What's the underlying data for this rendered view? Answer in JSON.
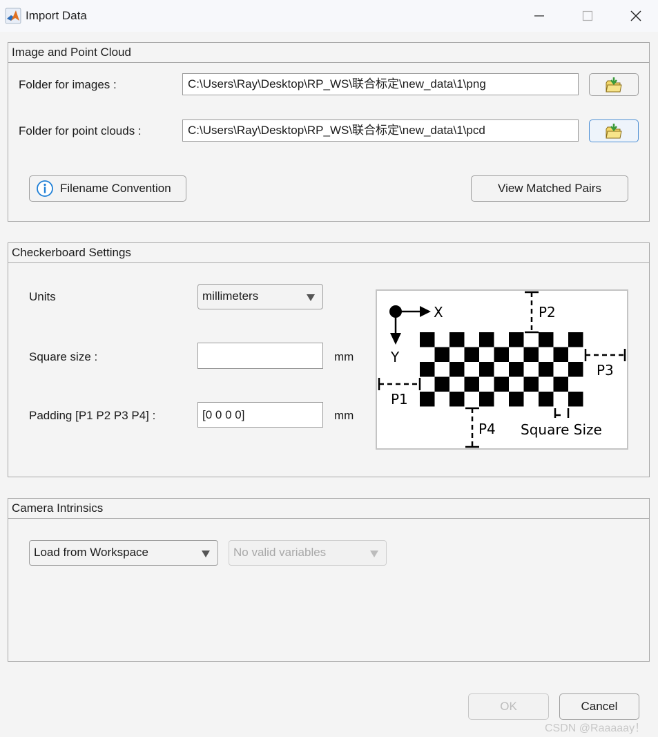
{
  "window": {
    "title": "Import Data",
    "app_icon": "matlab-icon",
    "controls": [
      "minimize-icon",
      "maximize-icon",
      "close-icon"
    ]
  },
  "image_panel": {
    "title": "Image and Point Cloud",
    "images_label": "Folder for images :",
    "images_path": "C:\\Users\\Ray\\Desktop\\RP_WS\\联合标定\\new_data\\1\\png",
    "clouds_label": "Folder for point clouds :",
    "clouds_path": "C:\\Users\\Ray\\Desktop\\RP_WS\\联合标定\\new_data\\1\\pcd",
    "browse_icon": "folder-open-icon",
    "filename_convention_label": "Filename Convention",
    "view_pairs_label": "View Matched Pairs"
  },
  "checkerboard_panel": {
    "title": "Checkerboard Settings",
    "units_label": "Units",
    "units_value": "millimeters",
    "square_size_label": "Square size :",
    "square_size_value": "",
    "square_size_unit": "mm",
    "padding_label": "Padding [P1 P2 P3 P4] :",
    "padding_value": "[0 0 0 0]",
    "padding_unit": "mm",
    "diagram": {
      "x_label": "X",
      "y_label": "Y",
      "p1": "P1",
      "p2": "P2",
      "p3": "P3",
      "p4": "P4",
      "square_size": "Square Size"
    }
  },
  "intrinsics_panel": {
    "title": "Camera Intrinsics",
    "source_value": "Load from Workspace",
    "variables_value": "No valid variables"
  },
  "footer": {
    "ok_label": "OK",
    "cancel_label": "Cancel"
  },
  "watermark": "CSDN @Raaaaay！",
  "colors": {
    "focus_border": "#4d8fd4",
    "info_blue": "#1e7fd6",
    "folder_yellow": "#f3d86a",
    "folder_arrow": "#3a9a3a"
  }
}
